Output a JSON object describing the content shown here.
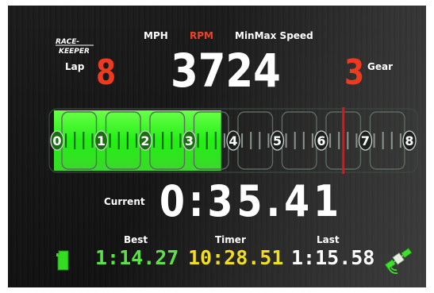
{
  "header": {
    "logo_text": "RACE-KEEPER",
    "modes": {
      "mph": "MPH",
      "rpm": "RPM",
      "minmax": "MinMax Speed"
    },
    "active_mode": "RPM"
  },
  "lap": {
    "label": "Lap",
    "value": "8"
  },
  "rpm": {
    "value": "3724",
    "current": 3724,
    "max_tick": 8000,
    "redline": 6500
  },
  "gear": {
    "label": "Gear",
    "value": "3"
  },
  "gauge": {
    "ticks": [
      "0",
      "1",
      "2",
      "3",
      "4",
      "5",
      "6",
      "7",
      "8"
    ]
  },
  "current": {
    "label": "Current",
    "value": "0:35.41"
  },
  "times": {
    "best_label": "Best",
    "best_value": "1:14.27",
    "timer_label": "Timer",
    "timer_value": "10:28.51",
    "last_label": "Last",
    "last_value": "1:15.58"
  },
  "icons": {
    "storage": "sd-card-icon",
    "gps": "satellite-icon"
  },
  "colors": {
    "accent_red": "#ee3a1f",
    "green": "#5fe04a",
    "yellow": "#f2df1c",
    "bar_fill": "#2cff1a"
  }
}
